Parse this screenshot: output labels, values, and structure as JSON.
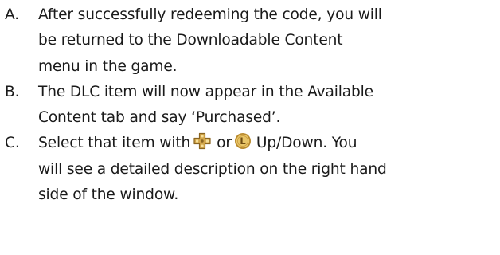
{
  "document": {
    "items": [
      {
        "marker": "A.",
        "lines": [
          "After successfully redeeming the code, you will",
          "be returned to the Downloadable Content",
          "menu in the game."
        ]
      },
      {
        "marker": "B.",
        "lines": [
          "The DLC item will now appear in the Available",
          "Content tab and say ‘Purchased’."
        ]
      },
      {
        "marker": "C.",
        "line1_before_icon": "Select that item with",
        "line1_between_icons": "or",
        "line1_after_icon": "Up/Down.  You",
        "lines": [
          "will see a detailed description on the right hand",
          "side of the window."
        ]
      }
    ],
    "icons": {
      "dpad": "dpad-icon",
      "left_stick": "left-stick-icon",
      "left_stick_letter": "L"
    },
    "colors": {
      "text": "#1a1a1a",
      "dpad_gold": "#d2a64a",
      "dpad_dark": "#8a6420",
      "stick_outer": "#b98a2e",
      "stick_inner": "#e8c568"
    }
  }
}
